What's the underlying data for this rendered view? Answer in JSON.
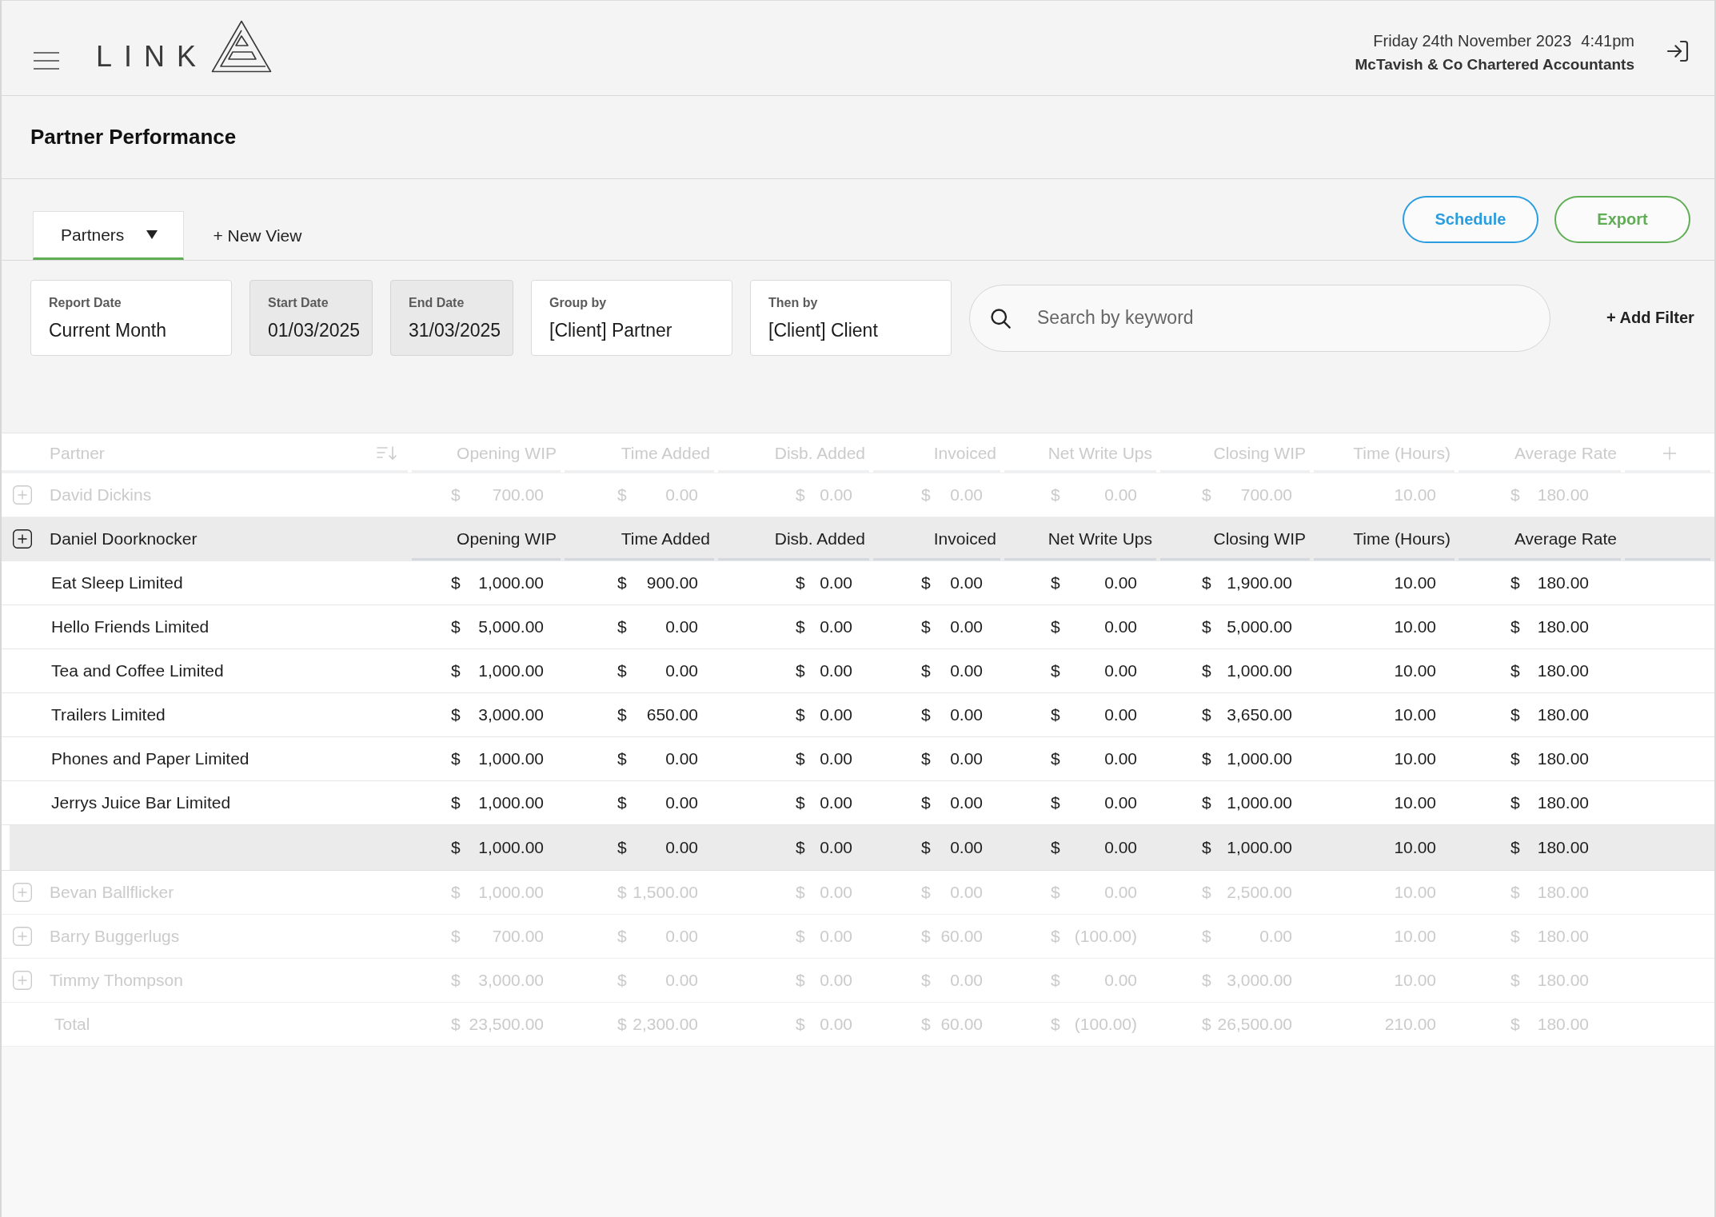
{
  "header": {
    "logo": "LINK",
    "date": "Friday 24th November 2023",
    "time": "4:41pm",
    "company": "McTavish & Co Chartered Accountants"
  },
  "page_title": "Partner Performance",
  "views": {
    "tabs": [
      {
        "label": "Partners",
        "selected": true
      }
    ],
    "new_view": "+ New View"
  },
  "actions": [
    {
      "label": "Schedule",
      "color": "#2a9de0"
    },
    {
      "label": "Export",
      "color": "#5fae55"
    }
  ],
  "filters": [
    {
      "label": "Report Date",
      "value": "Current Month",
      "disabled": false
    },
    {
      "label": "Start Date",
      "value": "01/03/2025",
      "disabled": true
    },
    {
      "label": "End Date",
      "value": "31/03/2025",
      "disabled": true
    },
    {
      "label": "Group by",
      "value": "[Client] Partner",
      "disabled": false
    },
    {
      "label": "Then by",
      "value": "[Client] Client",
      "disabled": false
    }
  ],
  "search": {
    "placeholder": "Search by keyword"
  },
  "add_filter": "+ Add Filter",
  "table": {
    "header": {
      "dimmed": true,
      "label": "Partner",
      "columns": [
        "Opening WIP",
        "Time Added",
        "Disb. Added",
        "Invoiced",
        "Net Write Ups",
        "Closing WIP",
        "Time (Hours)",
        "Average Rate"
      ]
    },
    "partners": [
      {
        "name": "David Dickins",
        "expanded": false,
        "dimmed": true,
        "cells": [
          {
            "currency": "$",
            "amount": "700.00"
          },
          {
            "currency": "$",
            "amount": "0.00"
          },
          {
            "currency": "$",
            "amount": "0.00"
          },
          {
            "currency": "$",
            "amount": "0.00"
          },
          {
            "currency": "$",
            "amount": "0.00"
          },
          {
            "currency": "$",
            "amount": "700.00"
          },
          {
            "amount": "10.00"
          },
          {
            "currency": "$",
            "amount": "180.00"
          }
        ]
      },
      {
        "name": "Daniel Doorknocker",
        "expanded": true,
        "dimmed": false,
        "columns": [
          "Opening WIP",
          "Time Added",
          "Disb. Added",
          "Invoiced",
          "Net Write Ups",
          "Closing WIP",
          "Time (Hours)",
          "Average Rate"
        ],
        "clients": [
          {
            "name": "Eat Sleep Limited",
            "cells": [
              {
                "currency": "$",
                "amount": "1,000.00"
              },
              {
                "currency": "$",
                "amount": "900.00"
              },
              {
                "currency": "$",
                "amount": "0.00"
              },
              {
                "currency": "$",
                "amount": "0.00"
              },
              {
                "currency": "$",
                "amount": "0.00"
              },
              {
                "currency": "$",
                "amount": "1,900.00"
              },
              {
                "amount": "10.00"
              },
              {
                "currency": "$",
                "amount": "180.00"
              }
            ]
          },
          {
            "name": "Hello Friends Limited",
            "cells": [
              {
                "currency": "$",
                "amount": "5,000.00"
              },
              {
                "currency": "$",
                "amount": "0.00"
              },
              {
                "currency": "$",
                "amount": "0.00"
              },
              {
                "currency": "$",
                "amount": "0.00"
              },
              {
                "currency": "$",
                "amount": "0.00"
              },
              {
                "currency": "$",
                "amount": "5,000.00"
              },
              {
                "amount": "10.00"
              },
              {
                "currency": "$",
                "amount": "180.00"
              }
            ]
          },
          {
            "name": "Tea and Coffee Limited",
            "cells": [
              {
                "currency": "$",
                "amount": "1,000.00"
              },
              {
                "currency": "$",
                "amount": "0.00"
              },
              {
                "currency": "$",
                "amount": "0.00"
              },
              {
                "currency": "$",
                "amount": "0.00"
              },
              {
                "currency": "$",
                "amount": "0.00"
              },
              {
                "currency": "$",
                "amount": "1,000.00"
              },
              {
                "amount": "10.00"
              },
              {
                "currency": "$",
                "amount": "180.00"
              }
            ]
          },
          {
            "name": "Trailers Limited",
            "cells": [
              {
                "currency": "$",
                "amount": "3,000.00"
              },
              {
                "currency": "$",
                "amount": "650.00"
              },
              {
                "currency": "$",
                "amount": "0.00"
              },
              {
                "currency": "$",
                "amount": "0.00"
              },
              {
                "currency": "$",
                "amount": "0.00"
              },
              {
                "currency": "$",
                "amount": "3,650.00"
              },
              {
                "amount": "10.00"
              },
              {
                "currency": "$",
                "amount": "180.00"
              }
            ]
          },
          {
            "name": "Phones and Paper Limited",
            "cells": [
              {
                "currency": "$",
                "amount": "1,000.00"
              },
              {
                "currency": "$",
                "amount": "0.00"
              },
              {
                "currency": "$",
                "amount": "0.00"
              },
              {
                "currency": "$",
                "amount": "0.00"
              },
              {
                "currency": "$",
                "amount": "0.00"
              },
              {
                "currency": "$",
                "amount": "1,000.00"
              },
              {
                "amount": "10.00"
              },
              {
                "currency": "$",
                "amount": "180.00"
              }
            ]
          },
          {
            "name": "Jerrys Juice Bar Limited",
            "cells": [
              {
                "currency": "$",
                "amount": "1,000.00"
              },
              {
                "currency": "$",
                "amount": "0.00"
              },
              {
                "currency": "$",
                "amount": "0.00"
              },
              {
                "currency": "$",
                "amount": "0.00"
              },
              {
                "currency": "$",
                "amount": "0.00"
              },
              {
                "currency": "$",
                "amount": "1,000.00"
              },
              {
                "amount": "10.00"
              },
              {
                "currency": "$",
                "amount": "180.00"
              }
            ]
          }
        ],
        "subtotal": [
          {
            "currency": "$",
            "amount": "1,000.00"
          },
          {
            "currency": "$",
            "amount": "0.00"
          },
          {
            "currency": "$",
            "amount": "0.00"
          },
          {
            "currency": "$",
            "amount": "0.00"
          },
          {
            "currency": "$",
            "amount": "0.00"
          },
          {
            "currency": "$",
            "amount": "1,000.00"
          },
          {
            "amount": "10.00"
          },
          {
            "currency": "$",
            "amount": "180.00"
          }
        ]
      },
      {
        "name": "Bevan Ballflicker",
        "expanded": false,
        "dimmed": true,
        "cells": [
          {
            "currency": "$",
            "amount": "1,000.00"
          },
          {
            "currency": "$",
            "amount": "1,500.00"
          },
          {
            "currency": "$",
            "amount": "0.00"
          },
          {
            "currency": "$",
            "amount": "0.00"
          },
          {
            "currency": "$",
            "amount": "0.00"
          },
          {
            "currency": "$",
            "amount": "2,500.00"
          },
          {
            "amount": "10.00"
          },
          {
            "currency": "$",
            "amount": "180.00"
          }
        ]
      },
      {
        "name": "Barry Buggerlugs",
        "expanded": false,
        "dimmed": true,
        "cells": [
          {
            "currency": "$",
            "amount": "700.00"
          },
          {
            "currency": "$",
            "amount": "0.00"
          },
          {
            "currency": "$",
            "amount": "0.00"
          },
          {
            "currency": "$",
            "amount": "60.00"
          },
          {
            "currency": "$",
            "amount": "(100.00)"
          },
          {
            "currency": "$",
            "amount": "0.00"
          },
          {
            "amount": "10.00"
          },
          {
            "currency": "$",
            "amount": "180.00"
          }
        ]
      },
      {
        "name": "Timmy Thompson",
        "expanded": false,
        "dimmed": true,
        "cells": [
          {
            "currency": "$",
            "amount": "3,000.00"
          },
          {
            "currency": "$",
            "amount": "0.00"
          },
          {
            "currency": "$",
            "amount": "0.00"
          },
          {
            "currency": "$",
            "amount": "0.00"
          },
          {
            "currency": "$",
            "amount": "0.00"
          },
          {
            "currency": "$",
            "amount": "3,000.00"
          },
          {
            "amount": "10.00"
          },
          {
            "currency": "$",
            "amount": "180.00"
          }
        ]
      }
    ],
    "total": {
      "label": "Total",
      "dimmed": true,
      "cells": [
        {
          "currency": "$",
          "amount": "23,500.00"
        },
        {
          "currency": "$",
          "amount": "2,300.00"
        },
        {
          "currency": "$",
          "amount": "0.00"
        },
        {
          "currency": "$",
          "amount": "60.00"
        },
        {
          "currency": "$",
          "amount": "(100.00)"
        },
        {
          "currency": "$",
          "amount": "26,500.00"
        },
        {
          "amount": "210.00"
        },
        {
          "currency": "$",
          "amount": "180.00"
        }
      ]
    }
  }
}
